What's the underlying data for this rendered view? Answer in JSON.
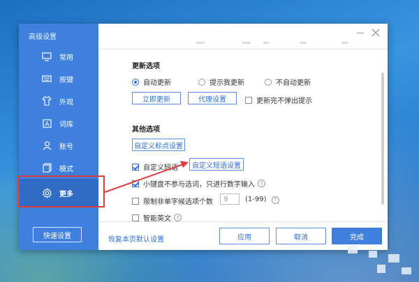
{
  "dialog": {
    "sidebar_title": "高级设置",
    "nav": [
      {
        "label": "常用",
        "icon": "monitor-icon"
      },
      {
        "label": "按键",
        "icon": "keyboard-icon"
      },
      {
        "label": "外观",
        "icon": "shirt-icon"
      },
      {
        "label": "词库",
        "icon": "dictionary-icon"
      },
      {
        "label": "账号",
        "icon": "user-icon"
      },
      {
        "label": "模式",
        "icon": "copy-icon"
      },
      {
        "label": "更多",
        "icon": "gear-icon",
        "active": true
      }
    ],
    "quick_settings": "快速设置"
  },
  "update": {
    "title": "更新选项",
    "radios": [
      "自动更新",
      "提示我更新",
      "不自动更新"
    ],
    "selected": "自动更新",
    "update_now": "立即更新",
    "proxy_settings": "代理设置",
    "no_popup_label": "更新完不弹出提示"
  },
  "other": {
    "title": "其他选项",
    "custom_punct_btn": "自定义标点设置",
    "custom_phrase_label": "自定义短语",
    "custom_phrase_btn": "自定义短语设置",
    "numpad_label": "小键盘不参与选词，只进行数字输入",
    "limit_label": "限制非单字候选项个数",
    "limit_value": "9",
    "limit_range": "(1-99)",
    "smart_english_label": "智能英文"
  },
  "footer": {
    "restore_defaults": "恢复本页默认设置",
    "apply": "应用",
    "cancel": "取消",
    "done": "完成"
  },
  "colors": {
    "accent": "#3f80df",
    "highlight": "#e03b3b"
  }
}
